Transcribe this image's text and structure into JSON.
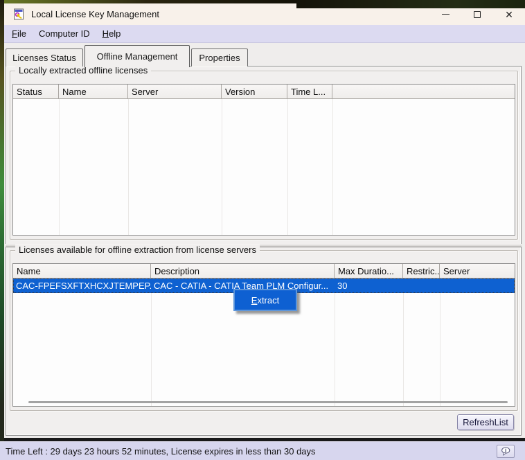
{
  "window": {
    "title": "Local License Key Management"
  },
  "menubar": {
    "items": [
      {
        "accel": "F",
        "rest": "ile"
      },
      {
        "accel": "",
        "rest": "Computer ID"
      },
      {
        "accel": "H",
        "rest": "elp"
      }
    ]
  },
  "tabs": [
    {
      "label": "Licenses Status",
      "active": false
    },
    {
      "label": "Offline Management",
      "active": true
    },
    {
      "label": "Properties",
      "active": false
    }
  ],
  "local_group": {
    "title": "Locally extracted offline licenses",
    "columns": [
      "Status",
      "Name",
      "Server",
      "Version",
      "Time L..."
    ],
    "rows": []
  },
  "available_group": {
    "title": "Licenses available for offline extraction from license servers",
    "columns": [
      "Name",
      "Description",
      "Max Duratio...",
      "Restric...",
      "Server"
    ],
    "rows": [
      {
        "name": "CAC-FPEFSXFTXHCXJTEMPEP...",
        "description": "CAC - CATIA - CATIA Team PLM Configur...",
        "max_duration": "30",
        "restriction": "",
        "server": "",
        "selected": true
      }
    ]
  },
  "context_menu": {
    "items": [
      {
        "accel": "E",
        "rest": "xtract"
      }
    ]
  },
  "buttons": {
    "refresh_list": "RefreshList"
  },
  "statusbar": {
    "text": "Time Left : 29 days 23 hours 52 minutes, License expires in less than 30 days",
    "icon": "help-balloon-icon"
  },
  "colors": {
    "selection_blue": "#0e61d1",
    "context_menu_blue": "#0e60d2",
    "context_menu_border": "#5e96da",
    "titlebar_bg": "#f8f1ea",
    "menubar_bg": "#dcdaf1",
    "statusbar_bg": "#d7d6ee",
    "dialog_bg": "#f1efee"
  }
}
